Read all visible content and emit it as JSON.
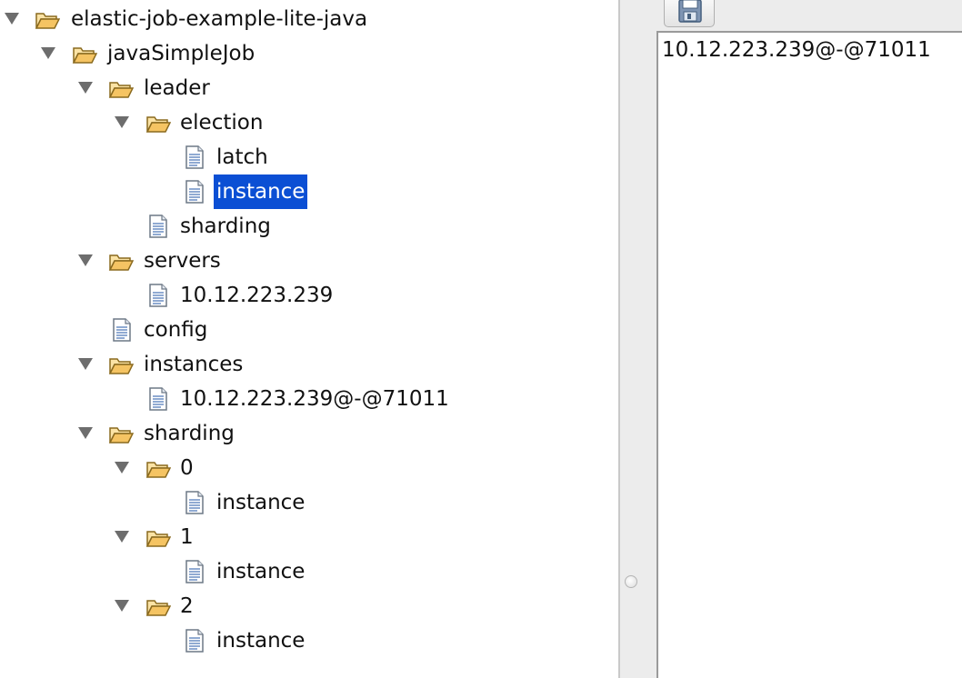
{
  "tree": {
    "nodes": [
      {
        "label": "elastic-job-example-lite-java",
        "type": "folder",
        "expanded": true
      },
      {
        "label": "javaSimpleJob",
        "type": "folder",
        "expanded": true
      },
      {
        "label": "leader",
        "type": "folder",
        "expanded": true
      },
      {
        "label": "election",
        "type": "folder",
        "expanded": true
      },
      {
        "label": "latch",
        "type": "file"
      },
      {
        "label": "instance",
        "type": "file",
        "selected": true
      },
      {
        "label": "sharding",
        "type": "file"
      },
      {
        "label": "servers",
        "type": "folder",
        "expanded": true
      },
      {
        "label": "10.12.223.239",
        "type": "file"
      },
      {
        "label": "config",
        "type": "file"
      },
      {
        "label": "instances",
        "type": "folder",
        "expanded": true
      },
      {
        "label": "10.12.223.239@-@71011",
        "type": "file"
      },
      {
        "label": "sharding",
        "type": "folder",
        "expanded": true
      },
      {
        "label": "0",
        "type": "folder",
        "expanded": true
      },
      {
        "label": "instance",
        "type": "file"
      },
      {
        "label": "1",
        "type": "folder",
        "expanded": true
      },
      {
        "label": "instance",
        "type": "file"
      },
      {
        "label": "2",
        "type": "folder",
        "expanded": true
      },
      {
        "label": "instance",
        "type": "file"
      }
    ]
  },
  "editor": {
    "value": "10.12.223.239@-@71011",
    "save_icon": "save-icon"
  },
  "colors": {
    "selection": "#0b4fd4",
    "folder": "#f5c463",
    "twisty": "#6d6d6d"
  }
}
